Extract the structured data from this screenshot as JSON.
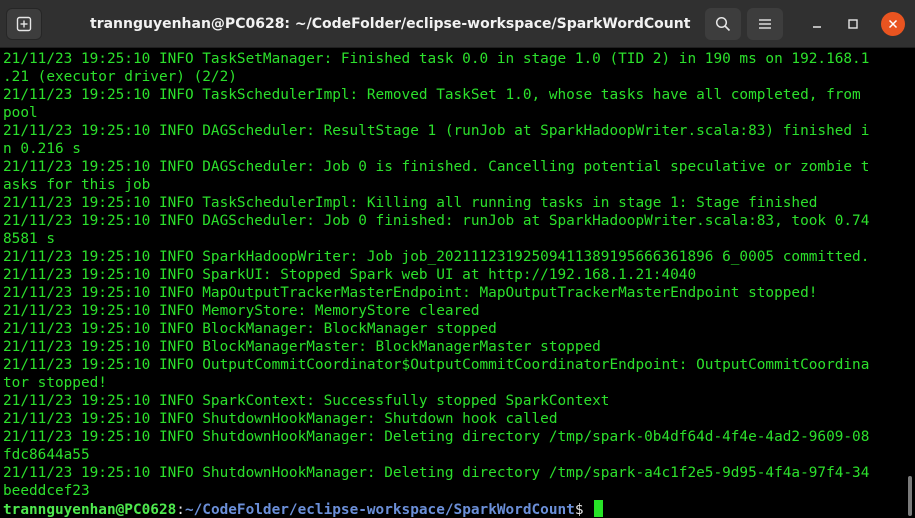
{
  "window": {
    "title": "trannguyenhan@PC0628: ~/CodeFolder/eclipse-workspace/SparkWordCount"
  },
  "icons": {
    "new_tab": "new-tab-icon",
    "search": "search-icon",
    "menu": "hamburger-menu-icon",
    "minimize": "minimize-icon",
    "maximize": "maximize-icon",
    "close": "close-icon"
  },
  "colors": {
    "titlebar": "#303030",
    "terminal_bg": "#000000",
    "output_text": "#2ce02c",
    "prompt_user": "#4ee94e",
    "prompt_path": "#6b8fd8",
    "close_button": "#e95420"
  },
  "terminal": {
    "lines": [
      "21/11/23 19:25:10 INFO TaskSetManager: Finished task 0.0 in stage 1.0 (TID 2) in 190 ms on 192.168.1",
      ".21 (executor driver) (2/2)",
      "21/11/23 19:25:10 INFO TaskSchedulerImpl: Removed TaskSet 1.0, whose tasks have all completed, from",
      "pool",
      "21/11/23 19:25:10 INFO DAGScheduler: ResultStage 1 (runJob at SparkHadoopWriter.scala:83) finished i",
      "n 0.216 s",
      "21/11/23 19:25:10 INFO DAGScheduler: Job 0 is finished. Cancelling potential speculative or zombie t",
      "asks for this job",
      "21/11/23 19:25:10 INFO TaskSchedulerImpl: Killing all running tasks in stage 1: Stage finished",
      "21/11/23 19:25:10 INFO DAGScheduler: Job 0 finished: runJob at SparkHadoopWriter.scala:83, took 0.74",
      "8581 s",
      "21/11/23 19:25:10 INFO SparkHadoopWriter: Job job_20211123192509411389195666361896 6_0005 committed.",
      "21/11/23 19:25:10 INFO SparkUI: Stopped Spark web UI at http://192.168.1.21:4040",
      "21/11/23 19:25:10 INFO MapOutputTrackerMasterEndpoint: MapOutputTrackerMasterEndpoint stopped!",
      "21/11/23 19:25:10 INFO MemoryStore: MemoryStore cleared",
      "21/11/23 19:25:10 INFO BlockManager: BlockManager stopped",
      "21/11/23 19:25:10 INFO BlockManagerMaster: BlockManagerMaster stopped",
      "21/11/23 19:25:10 INFO OutputCommitCoordinator$OutputCommitCoordinatorEndpoint: OutputCommitCoordina",
      "tor stopped!",
      "21/11/23 19:25:10 INFO SparkContext: Successfully stopped SparkContext",
      "21/11/23 19:25:10 INFO ShutdownHookManager: Shutdown hook called",
      "21/11/23 19:25:10 INFO ShutdownHookManager: Deleting directory /tmp/spark-0b4df64d-4f4e-4ad2-9609-08",
      "fdc8644a55",
      "21/11/23 19:25:10 INFO ShutdownHookManager: Deleting directory /tmp/spark-a4c1f2e5-9d95-4f4a-97f4-34",
      "beeddcef23"
    ],
    "prompt": {
      "user_host": "trannguyenhan@PC0628",
      "separator": ":",
      "path": "~/CodeFolder/eclipse-workspace/SparkWordCount",
      "symbol": "$ "
    }
  }
}
